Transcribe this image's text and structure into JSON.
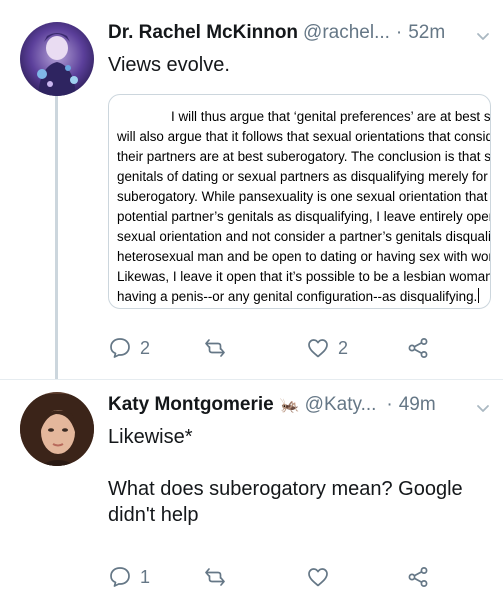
{
  "tweets": [
    {
      "display_name": "Dr. Rachel McKinnon",
      "handle": "@rachel...",
      "separator": "·",
      "time": "52m",
      "text": "Views evolve.",
      "attachment_lines": [
        "I will thus argue that ‘genital preferences’ are at best sub",
        "will also argue that it follows that sexual orientations that consid",
        "their partners are at best suberogatory. The conclusion is that s",
        "genitals of dating or sexual partners as disqualifying merely for",
        "suberogatory. While pansexuality is one sexual orientation that",
        "potential partner’s genitals as disqualifying, I leave entirely oper",
        "sexual orientation and not consider a partner’s genitals disquali",
        "heterosexual man and be open to dating or having sex with wor",
        "Likewas, I leave it open that it’s possible to be a lesbian woman",
        "having a penis--or any genital configuration--as disqualifying."
      ],
      "reply_count": "2",
      "retweet_count": "",
      "like_count": "2"
    },
    {
      "display_name": "Katy Montgomerie",
      "name_emoji": "🦗",
      "handle": "@Katy...",
      "separator": "·",
      "time": "49m",
      "text": "Likewise*\n\nWhat does suberogatory mean? Google didn't help",
      "reply_count": "1",
      "retweet_count": "",
      "like_count": ""
    }
  ],
  "icons": [
    "reply-icon",
    "retweet-icon",
    "like-icon",
    "share-icon",
    "chevron-down-icon"
  ],
  "colors": {
    "primary_text": "#14171a",
    "secondary_text": "#657786",
    "divider": "#e6ecf0",
    "thread_line": "#ccd6dd"
  }
}
